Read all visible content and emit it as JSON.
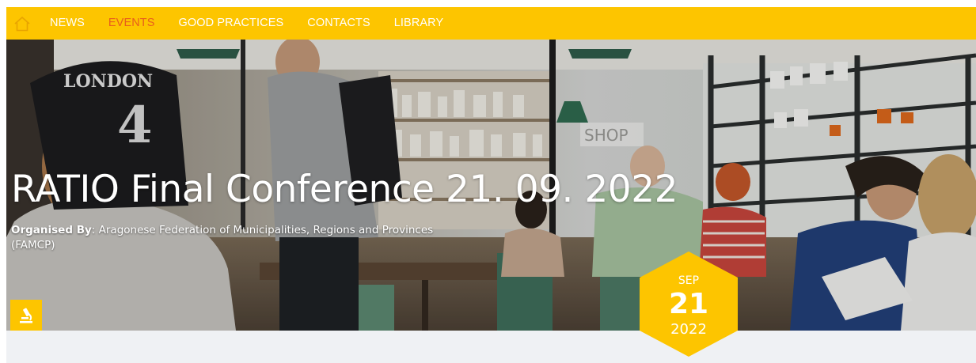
{
  "nav": {
    "home_icon": "home-icon",
    "items": [
      {
        "label": "NEWS",
        "active": false
      },
      {
        "label": "EVENTS",
        "active": true
      },
      {
        "label": "GOOD PRACTICES",
        "active": false
      },
      {
        "label": "CONTACTS",
        "active": false
      },
      {
        "label": "LIBRARY",
        "active": false
      }
    ]
  },
  "hero": {
    "title": "RATIO Final Conference 21. 09. 2022",
    "organiser_label": "Organised By",
    "organiser_value": ": Aragonese Federation of Municipalities, Regions and Provinces (FAMCP)",
    "background_text": {
      "shirt": "LONDON",
      "shirt_number": "4",
      "shop_sign": "SHOP"
    },
    "category_icon": "microscope-icon"
  },
  "date": {
    "month": "SEP",
    "day": "21",
    "year": "2022"
  },
  "colors": {
    "accent": "#fdc500",
    "active_nav": "#e85d1c",
    "strip": "#eff1f4"
  }
}
